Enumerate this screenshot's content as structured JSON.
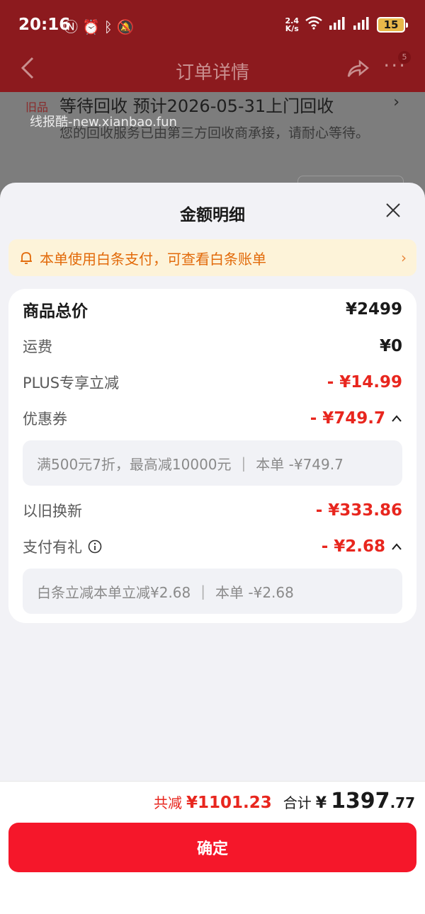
{
  "status_bar": {
    "time": "20:16",
    "speed_top": "2.4",
    "speed_unit": "K/s",
    "battery": "15"
  },
  "nav": {
    "title": "订单详情",
    "more_badge": "5"
  },
  "background": {
    "tag": "旧品",
    "status": "等待回收 预计2026-05-31上门回收",
    "desc": "您的回收服务已由第三方回收商承接，请耐心等待。",
    "watermark": "线报酷-new.xianbao.fun"
  },
  "sheet": {
    "title": "金额明细",
    "notice": "本单使用白条支付，可查看白条账单",
    "rows": {
      "total": {
        "label": "商品总价",
        "value": "¥2499"
      },
      "shipping": {
        "label": "运费",
        "value": "¥0"
      },
      "plus": {
        "label": "PLUS专享立减",
        "value": "- ¥14.99"
      },
      "coupon": {
        "label": "优惠券",
        "value": "- ¥749.7"
      },
      "tradein": {
        "label": "以旧换新",
        "value": "- ¥333.86"
      },
      "payment": {
        "label": "支付有礼",
        "value": "- ¥2.68"
      }
    },
    "coupon_detail": {
      "rule": "满500元7折，最高减10000元",
      "sep": "|",
      "amount": "本单 -¥749.7"
    },
    "payment_detail": {
      "rule": "白条立减本单立减¥2.68",
      "sep": "|",
      "amount": "本单 -¥2.68"
    }
  },
  "footer": {
    "reduce_label": "共减",
    "reduce_value": "¥1101.23",
    "total_label": "合计",
    "total_yen": "¥",
    "total_int": "1397",
    "total_dec": ".77",
    "confirm": "确定"
  },
  "colors": {
    "accent_red": "#e8261e",
    "button_red": "#f5172a",
    "notice_orange": "#e26a0a",
    "notice_bg": "#fdf3d9"
  },
  "icons": [
    "nfc-icon",
    "alarm-icon",
    "bluetooth-icon",
    "mute-icon",
    "wifi-icon",
    "signal-icon",
    "battery-icon",
    "back-icon",
    "share-icon",
    "more-icon",
    "close-icon",
    "bell-icon",
    "chevron-right-icon",
    "chevron-up-icon",
    "info-icon"
  ]
}
